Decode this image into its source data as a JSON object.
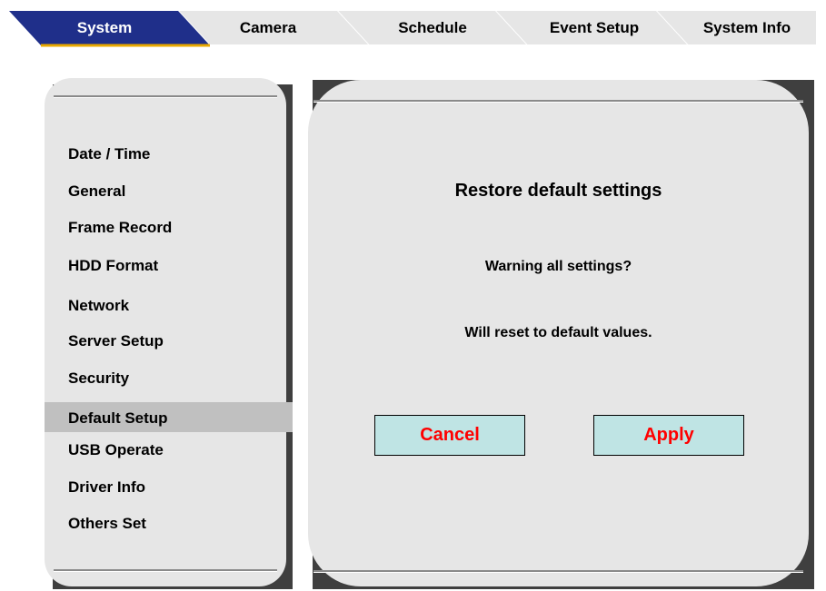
{
  "tabs": [
    {
      "label": "System",
      "active": true
    },
    {
      "label": "Camera",
      "active": false
    },
    {
      "label": "Schedule",
      "active": false
    },
    {
      "label": "Event Setup",
      "active": false
    },
    {
      "label": "System Info",
      "active": false
    }
  ],
  "sidebar": {
    "items": [
      {
        "label": "Date / Time"
      },
      {
        "label": "General"
      },
      {
        "label": "Frame Record"
      },
      {
        "label": "HDD Format"
      },
      {
        "label": "Network"
      },
      {
        "label": "Server Setup"
      },
      {
        "label": "Security"
      },
      {
        "label": "Default Setup",
        "selected": true
      },
      {
        "label": "USB Operate"
      },
      {
        "label": "Driver Info"
      },
      {
        "label": "Others Set"
      }
    ]
  },
  "dialog": {
    "title": "Restore default settings",
    "warning_line1": "Warning all  settings?",
    "warning_line2": "Will reset to default values.",
    "cancel_label": "Cancel",
    "apply_label": "Apply"
  },
  "colors": {
    "active_tab_bg": "#1f2f8a",
    "active_tab_text": "#ffffff",
    "inactive_tab_bg": "#e6e6e6",
    "tab_underline": "#e8a800",
    "panel_bg": "#e6e6e6",
    "selected_item_bg": "#c0c0c0",
    "button_bg": "#bfe4e4",
    "button_text": "#ff0000"
  }
}
